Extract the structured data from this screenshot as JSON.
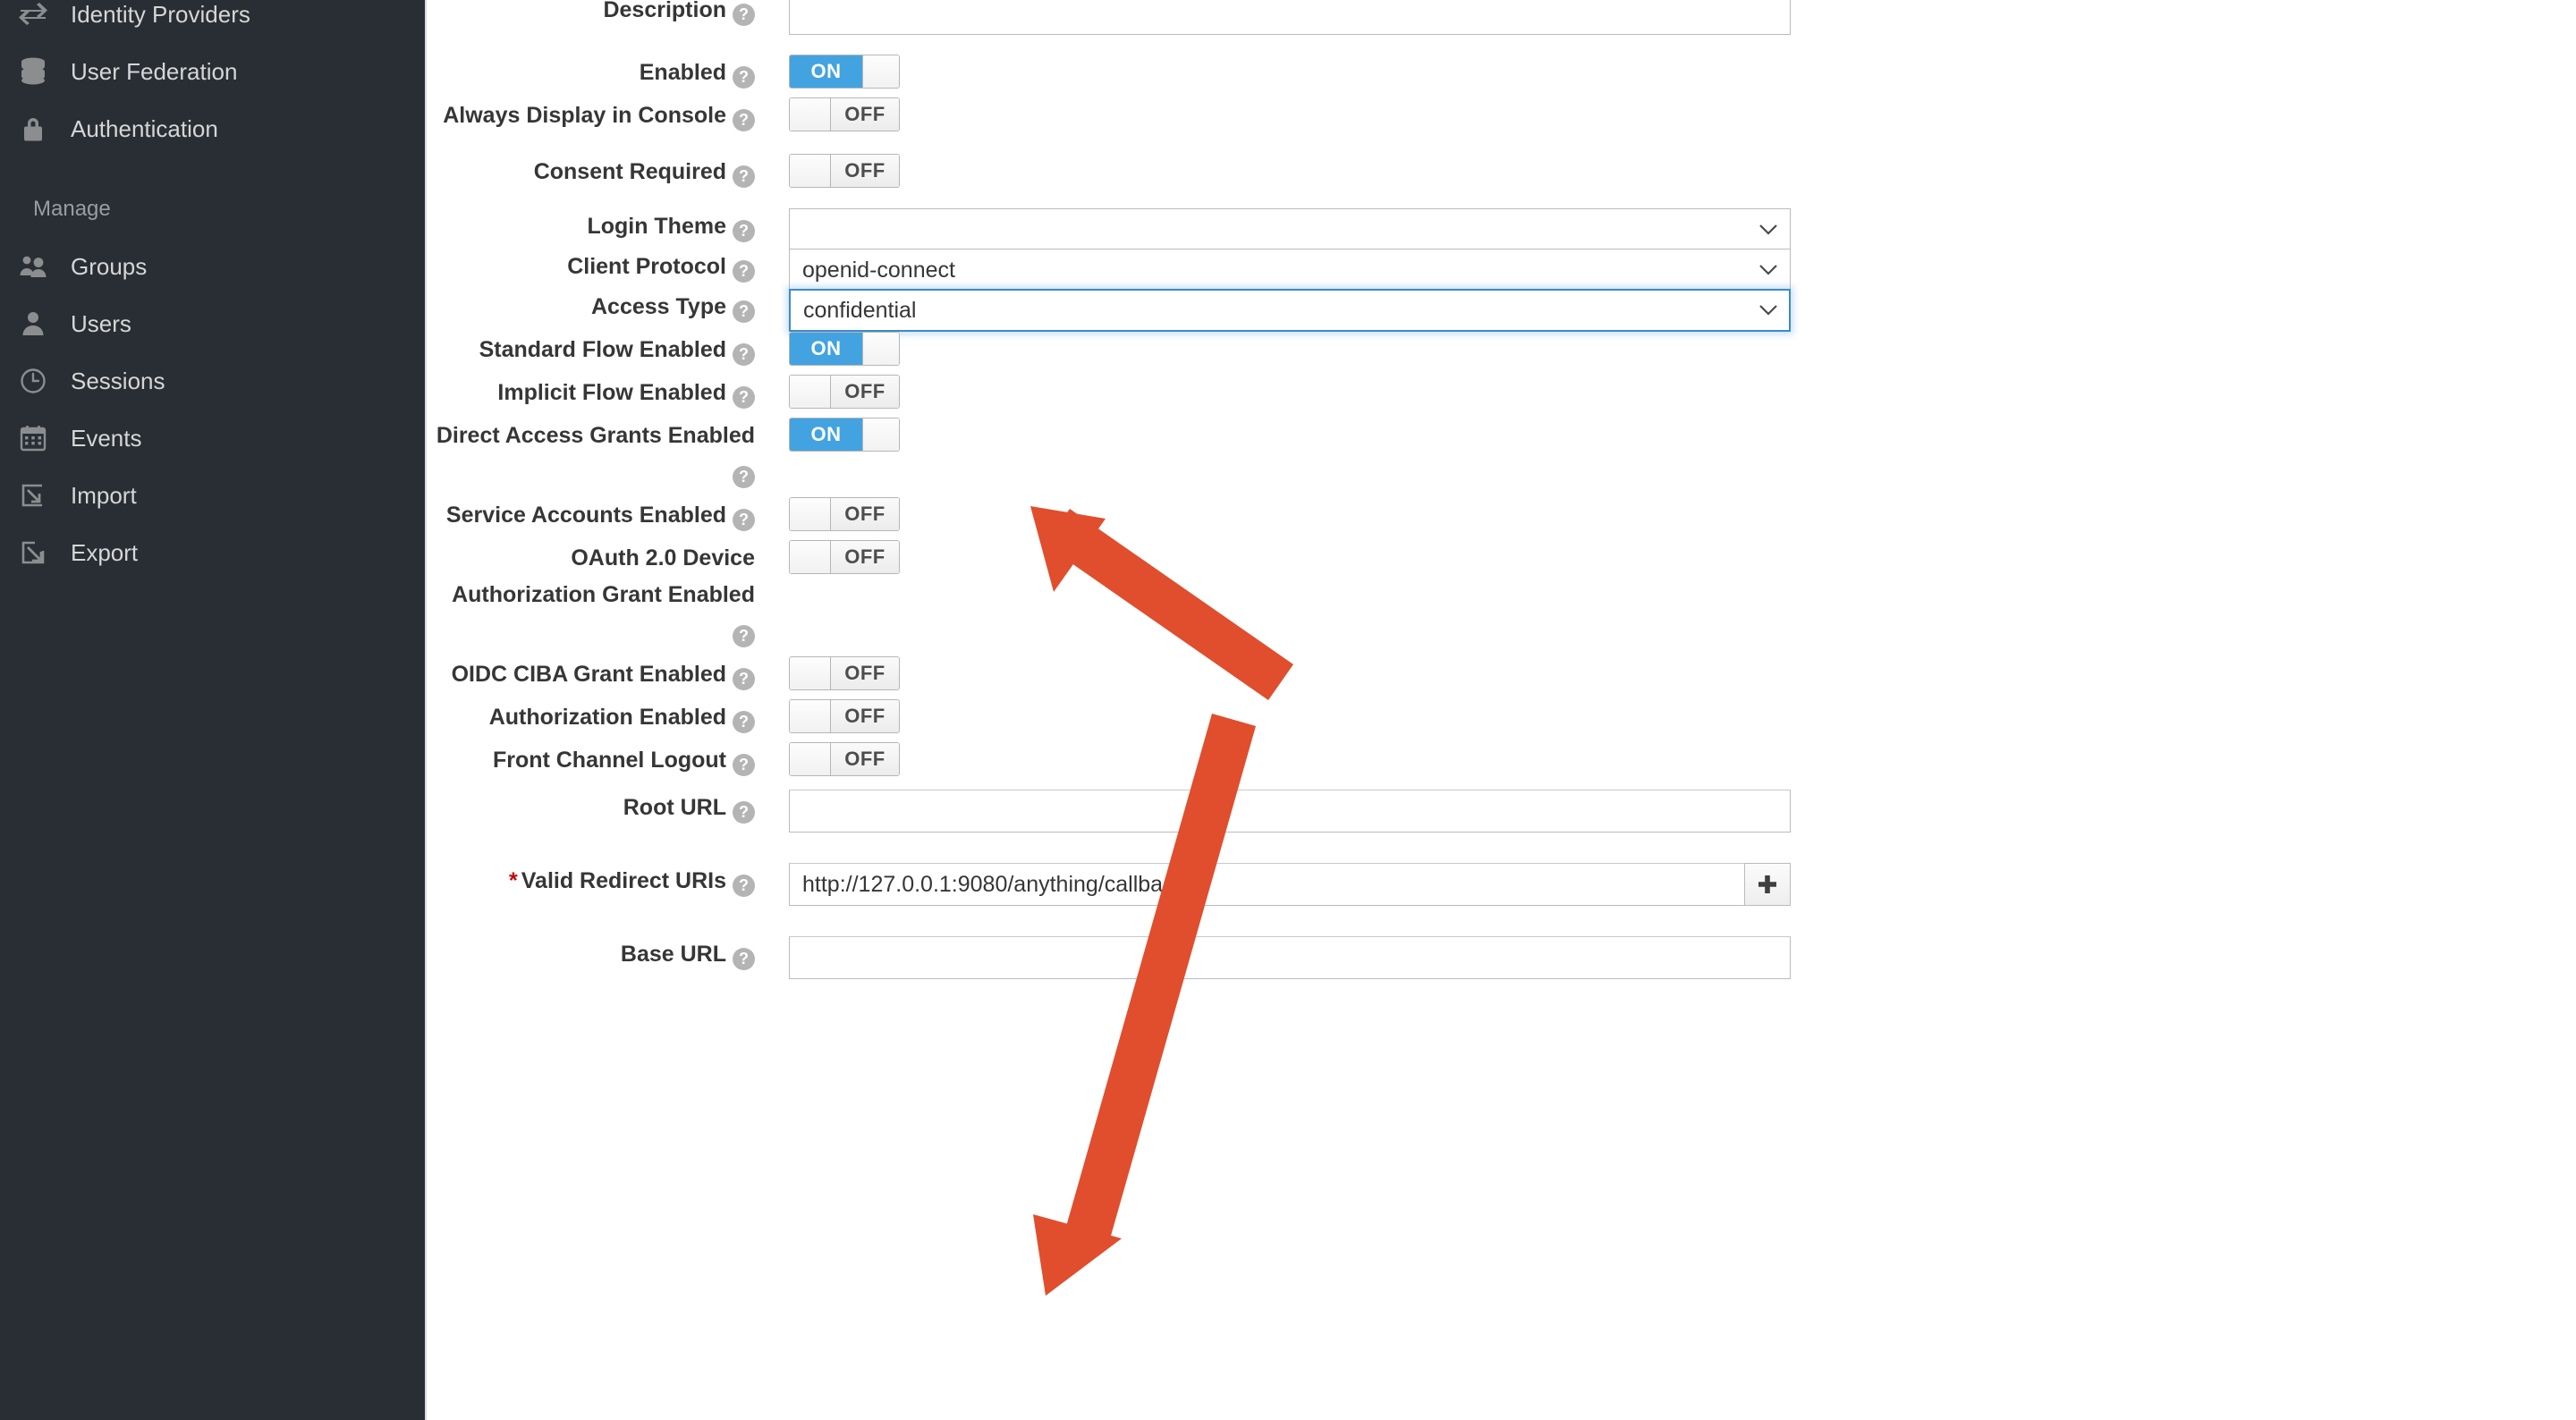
{
  "sidebar": {
    "items_top": [
      {
        "label": "Identity Providers",
        "icon": "exchange-icon"
      },
      {
        "label": "User Federation",
        "icon": "database-icon"
      },
      {
        "label": "Authentication",
        "icon": "lock-icon"
      }
    ],
    "section_label": "Manage",
    "items_manage": [
      {
        "label": "Groups",
        "icon": "group-users-icon"
      },
      {
        "label": "Users",
        "icon": "user-icon"
      },
      {
        "label": "Sessions",
        "icon": "clock-icon"
      },
      {
        "label": "Events",
        "icon": "calendar-icon"
      },
      {
        "label": "Import",
        "icon": "import-arrow-icon"
      },
      {
        "label": "Export",
        "icon": "export-arrow-icon"
      }
    ]
  },
  "help_glyph": "?",
  "required_marker": "*",
  "form": {
    "description": {
      "label": "Description",
      "value": "",
      "placeholder": ""
    },
    "enabled": {
      "label": "Enabled",
      "state": "ON"
    },
    "always_display_in_console": {
      "label": "Always Display in Console",
      "state": "OFF"
    },
    "consent_required": {
      "label": "Consent Required",
      "state": "OFF"
    },
    "login_theme": {
      "label": "Login Theme",
      "value": ""
    },
    "client_protocol": {
      "label": "Client Protocol",
      "value": "openid-connect"
    },
    "access_type": {
      "label": "Access Type",
      "value": "confidential",
      "focused": true
    },
    "standard_flow_enabled": {
      "label": "Standard Flow Enabled",
      "state": "ON"
    },
    "implicit_flow_enabled": {
      "label": "Implicit Flow Enabled",
      "state": "OFF"
    },
    "direct_access_grants_enabled": {
      "label": "Direct Access Grants Enabled",
      "state": "ON"
    },
    "service_accounts_enabled": {
      "label": "Service Accounts Enabled",
      "state": "OFF"
    },
    "oauth_device_grant_enabled": {
      "label": "OAuth 2.0 Device Authorization Grant Enabled",
      "state": "OFF"
    },
    "oidc_ciba_grant_enabled": {
      "label": "OIDC CIBA Grant Enabled",
      "state": "OFF"
    },
    "authorization_enabled": {
      "label": "Authorization Enabled",
      "state": "OFF"
    },
    "front_channel_logout": {
      "label": "Front Channel Logout",
      "state": "OFF"
    },
    "root_url": {
      "label": "Root URL",
      "value": ""
    },
    "valid_redirect_uris": {
      "label": "Valid Redirect URIs",
      "value": "http://127.0.0.1:9080/anything/callback",
      "add_label": "+",
      "required": true
    },
    "base_url": {
      "label": "Base URL",
      "value": ""
    }
  },
  "annotations": {
    "arrow_color": "#e04e2d",
    "arrow_to_access_type": "points up-left at the Access Type dropdown",
    "arrow_to_valid_redirect_uris": "points down-left at the Valid Redirect URIs field"
  },
  "colors": {
    "sidebar_bg": "#292e34",
    "toggle_on_blue": "#42a3e0",
    "focus_blue": "#3c8acb",
    "required_red": "#cc0000",
    "annotation_orange": "#e04e2d"
  }
}
